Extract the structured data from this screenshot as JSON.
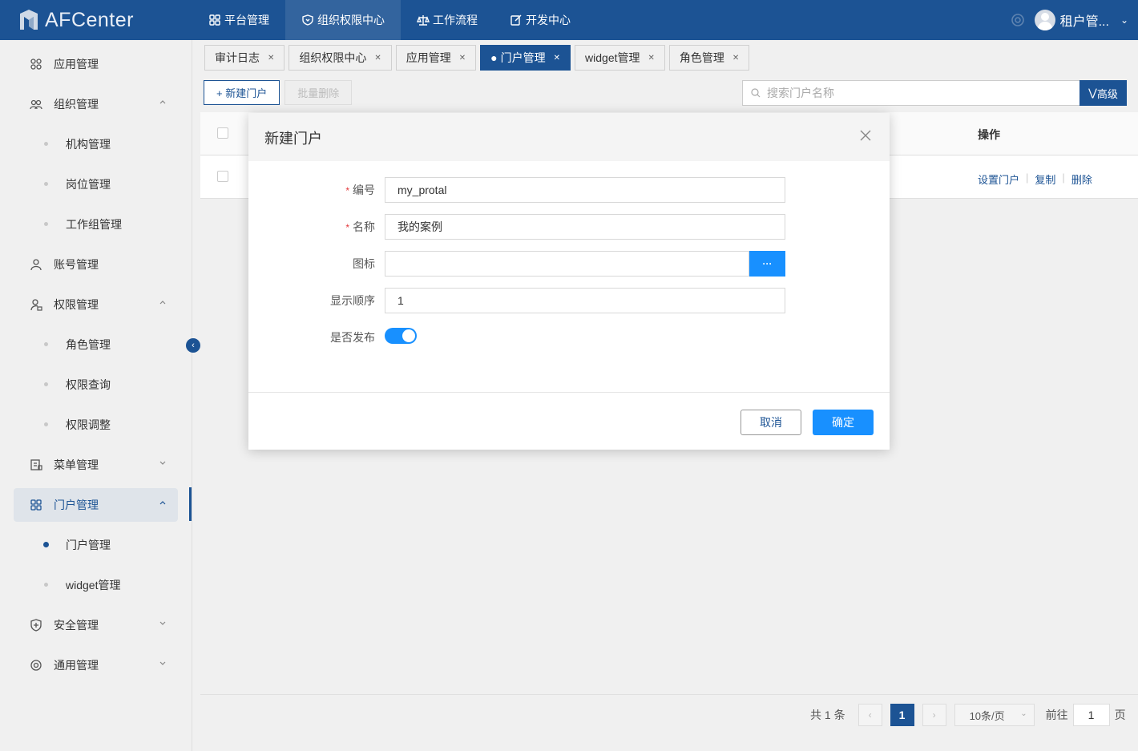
{
  "app": {
    "name": "AFCenter"
  },
  "topnav": [
    {
      "label": "平台管理"
    },
    {
      "label": "组织权限中心"
    },
    {
      "label": "工作流程"
    },
    {
      "label": "开发中心"
    }
  ],
  "user": {
    "name": "租户管..."
  },
  "sidebar": {
    "items": [
      {
        "label": "应用管理"
      },
      {
        "label": "组织管理"
      },
      {
        "label": "机构管理"
      },
      {
        "label": "岗位管理"
      },
      {
        "label": "工作组管理"
      },
      {
        "label": "账号管理"
      },
      {
        "label": "权限管理"
      },
      {
        "label": "角色管理"
      },
      {
        "label": "权限查询"
      },
      {
        "label": "权限调整"
      },
      {
        "label": "菜单管理"
      },
      {
        "label": "门户管理"
      },
      {
        "label": "门户管理"
      },
      {
        "label": "widget管理"
      },
      {
        "label": "安全管理"
      },
      {
        "label": "通用管理"
      }
    ]
  },
  "tabs": [
    {
      "label": "审计日志"
    },
    {
      "label": "组织权限中心"
    },
    {
      "label": "应用管理"
    },
    {
      "label": "门户管理"
    },
    {
      "label": "widget管理"
    },
    {
      "label": "角色管理"
    }
  ],
  "toolbar": {
    "new_label": "+ 新建门户",
    "batch_delete_label": "批量删除"
  },
  "search": {
    "placeholder": "搜索门户名称",
    "advanced_label": "高级"
  },
  "table": {
    "ops_header": "操作",
    "row_actions": [
      "设置门户",
      "复制",
      "删除"
    ]
  },
  "pagination": {
    "total": "共 1 条",
    "current_page": "1",
    "page_size": "10条/页",
    "goto_label": "前往",
    "goto_value": "1",
    "page_suffix": "页"
  },
  "dialog": {
    "title": "新建门户",
    "fields": {
      "code": {
        "label": "编号",
        "value": "my_protal"
      },
      "name": {
        "label": "名称",
        "value": "我的案例"
      },
      "icon": {
        "label": "图标",
        "value": "",
        "button": "···"
      },
      "order": {
        "label": "显示顺序",
        "value": "1"
      },
      "publish": {
        "label": "是否发布",
        "value": true
      }
    },
    "cancel_label": "取消",
    "ok_label": "确定"
  },
  "colors": {
    "primary": "#1c5394",
    "accent": "#1890ff",
    "required": "#e4393c"
  }
}
